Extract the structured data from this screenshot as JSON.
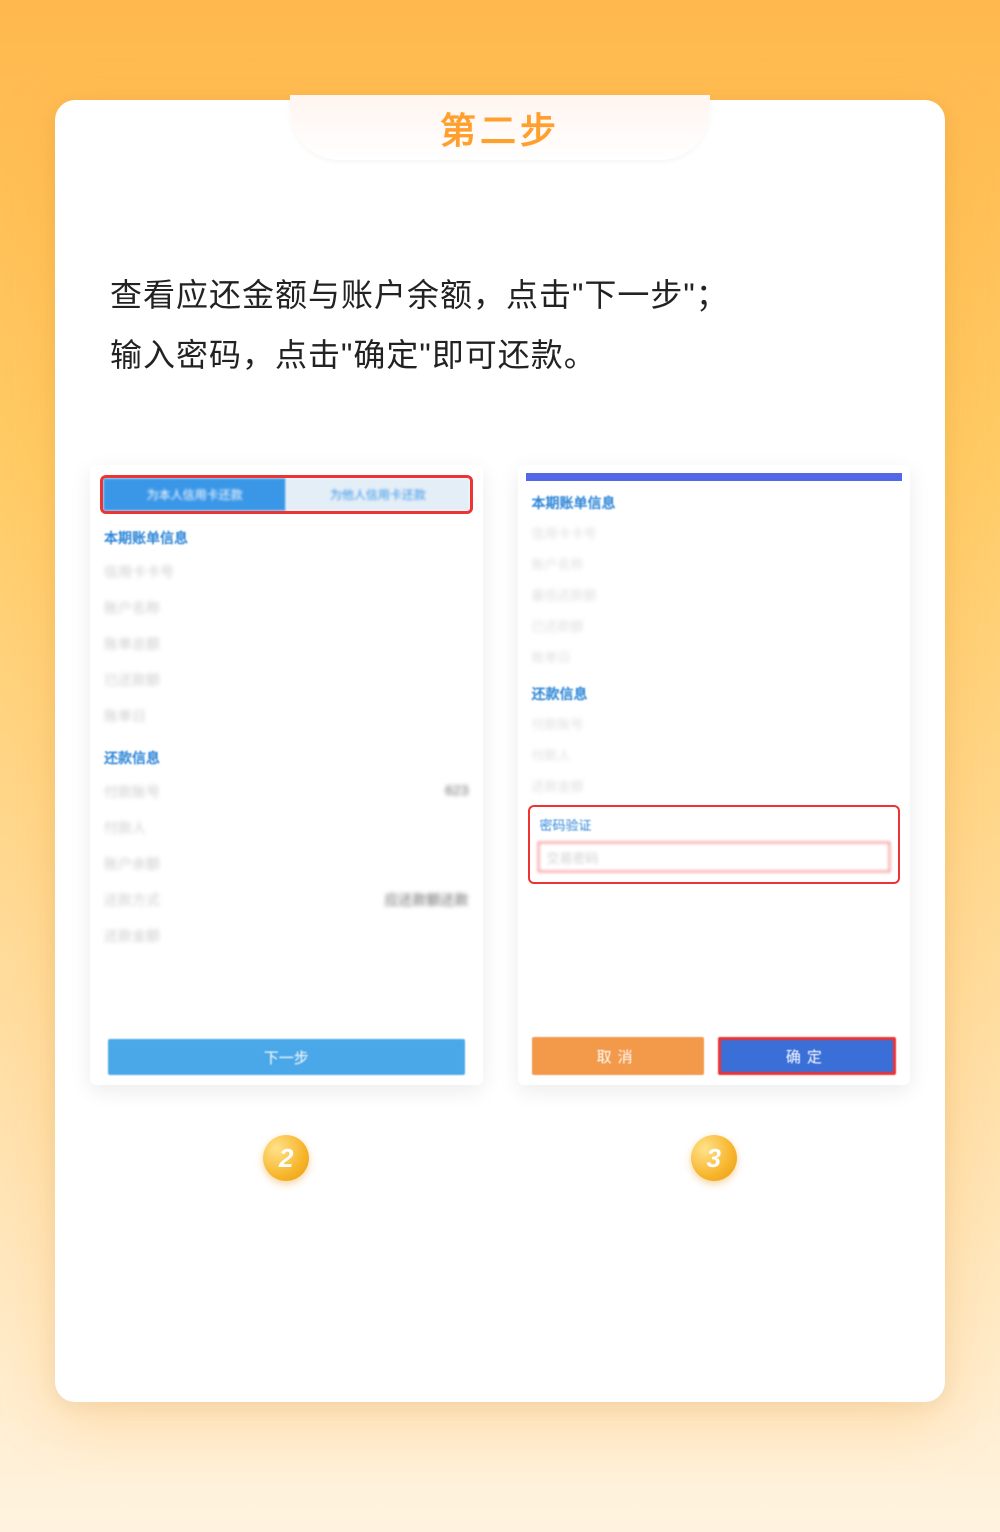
{
  "header": {
    "step_title": "第二步"
  },
  "description": {
    "line1": "查看应还金额与账户余额，点击\"下一步\"；",
    "line2": "输入密码，点击\"确定\"即可还款。"
  },
  "left_phone": {
    "tab_active": "为本人信用卡还款",
    "tab_inactive": "为他人信用卡还款",
    "section1_title": "本期账单信息",
    "rows1": [
      "信用卡卡号",
      "账户名称",
      "账单总额",
      "已还款额",
      "账单日"
    ],
    "section2_title": "还款信息",
    "row_card_label": "付款账号",
    "row_card_value": "623",
    "row_payer": "付款人",
    "row_balance": "账户余额",
    "row_method_label": "还款方式",
    "row_method_value": "应还款额还款",
    "row_amount": "还款金额",
    "next_button": "下一步"
  },
  "right_phone": {
    "section1_title": "本期账单信息",
    "rows1": [
      "信用卡卡号",
      "账户名称",
      "最低还款额",
      "已还款额",
      "账单日"
    ],
    "section2_title": "还款信息",
    "rows2": [
      "付款账号",
      "付款人",
      "还款金额"
    ],
    "pw_section_title": "密码验证",
    "pw_placeholder": "交易密码",
    "cancel_button": "取消",
    "confirm_button": "确定"
  },
  "badges": {
    "left": "2",
    "right": "3"
  }
}
